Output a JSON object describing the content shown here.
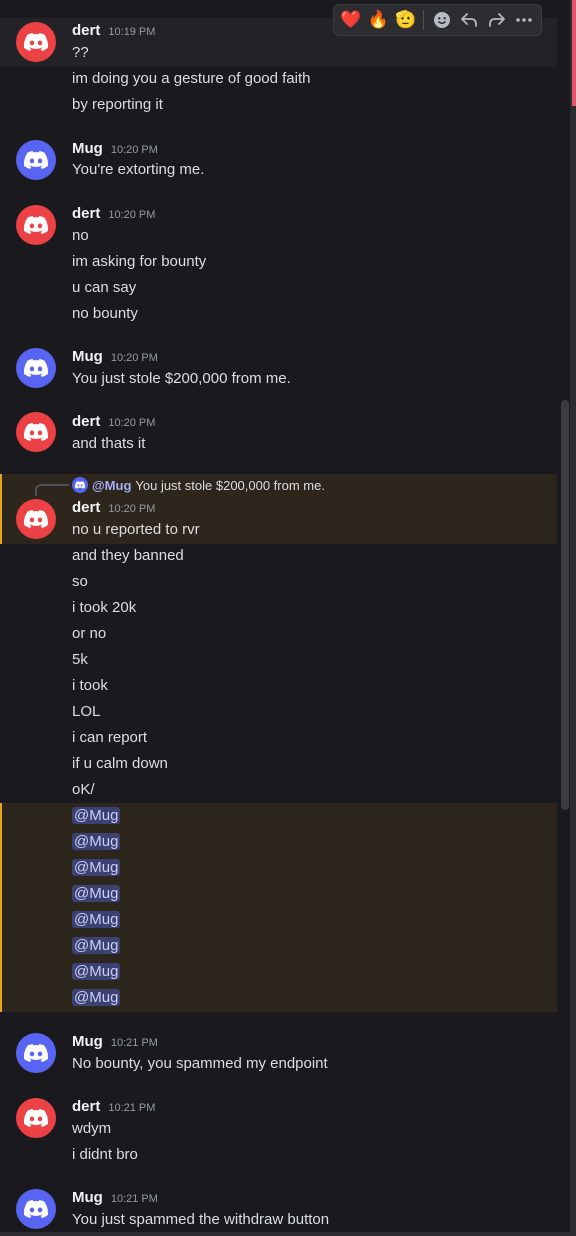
{
  "colors": {
    "dert_avatar": "#ed4245",
    "mug_avatar": "#5865f2",
    "highlight_border": "#e9a31a"
  },
  "toolbar": {
    "reactions": [
      "❤️",
      "🔥",
      "🫡"
    ],
    "buttons": [
      "add-reaction-icon",
      "reply-icon",
      "forward-icon",
      "more-icon"
    ]
  },
  "messages": [
    {
      "author": "dert",
      "time": "10:19 PM",
      "lines": [
        "??",
        "im doing you a gesture of good faith",
        "by reporting it"
      ]
    },
    {
      "author": "Mug",
      "time": "10:20 PM",
      "lines": [
        "You're extorting me."
      ]
    },
    {
      "author": "dert",
      "time": "10:20 PM",
      "lines": [
        "no",
        "im asking for bounty",
        "u can say",
        "no bounty"
      ]
    },
    {
      "author": "Mug",
      "time": "10:20 PM",
      "lines": [
        "You just stole $200,000 from me."
      ]
    },
    {
      "author": "dert",
      "time": "10:20 PM",
      "lines": [
        "and thats it"
      ]
    },
    {
      "reply_author": "@Mug",
      "reply_text": "You just stole $200,000 from me.",
      "author": "dert",
      "time": "10:20 PM",
      "lines": [
        "no u reported to rvr",
        "and they banned",
        "so",
        "i took 20k",
        "or no",
        "5k",
        "i took",
        "LOL",
        "i can report",
        "if u calm down",
        "oK/"
      ],
      "mentions": [
        "@Mug",
        "@Mug",
        "@Mug",
        "@Mug",
        "@Mug",
        "@Mug",
        "@Mug",
        "@Mug"
      ]
    },
    {
      "author": "Mug",
      "time": "10:21 PM",
      "lines": [
        "No bounty, you spammed my endpoint"
      ]
    },
    {
      "author": "dert",
      "time": "10:21 PM",
      "lines": [
        "wdym",
        "i didnt bro"
      ]
    },
    {
      "author": "Mug",
      "time": "10:21 PM",
      "lines": [
        "You just spammed the withdraw button"
      ]
    }
  ]
}
